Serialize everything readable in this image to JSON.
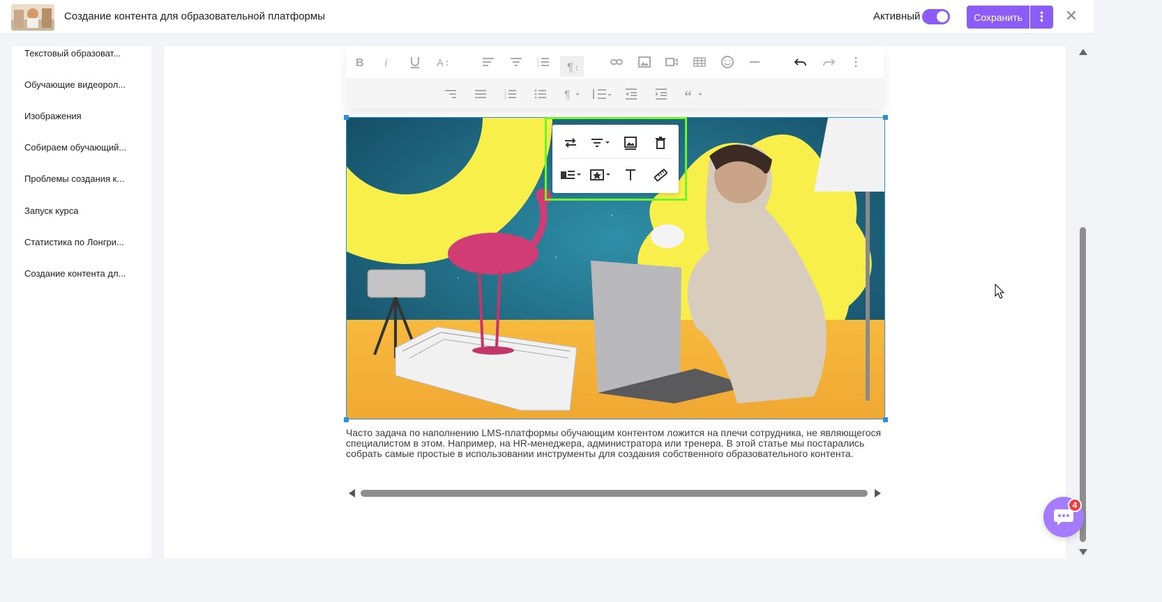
{
  "header": {
    "title": "Создание контента для образовательной платформы",
    "active_label": "Активный",
    "active_on": true,
    "save_label": "Сохранить",
    "more_icon": "vertical-dots-icon",
    "close_icon": "close-icon"
  },
  "sidebar": {
    "items": [
      {
        "label": "Текстовый образоват..."
      },
      {
        "label": "Обучающие видеорол..."
      },
      {
        "label": "Изображения"
      },
      {
        "label": "Собираем обучающий..."
      },
      {
        "label": "Проблемы создания к..."
      },
      {
        "label": "Запуск курса"
      },
      {
        "label": "Статистика по Лонгри..."
      },
      {
        "label": "Создание контента дл..."
      }
    ]
  },
  "toolbar": {
    "row1": [
      "bold-icon",
      "italic-icon",
      "underline-icon",
      "font-size-icon",
      "align-left-icon",
      "align-center-icon",
      "ordered-list-icon",
      "paragraph-format-icon",
      "link-icon",
      "image-icon",
      "video-icon",
      "table-icon",
      "emoji-icon",
      "horizontal-line-icon",
      "undo-icon",
      "redo-icon",
      "more-icon"
    ],
    "row2": [
      "align-right-icon",
      "align-justify-icon",
      "ordered-list-icon",
      "unordered-list-icon",
      "paragraph-style-icon",
      "line-height-icon",
      "outdent-icon",
      "indent-icon",
      "quote-icon"
    ]
  },
  "image_popup": {
    "icons": [
      "replace-image-icon",
      "align-image-icon",
      "insert-image-icon",
      "remove-image-icon",
      "display-icon",
      "style-icon",
      "alt-text-icon",
      "resize-ruler-icon"
    ]
  },
  "article": {
    "text": "Часто задача по наполнению LMS-платформы обучающим контентом ложится на плечи сотрудника, не являющегося специалистом в этом. Например, на HR-менеджера, администратора или тренера. В этой статье мы постарались собрать самые простые в использовании инструменты для создания собственного образовательного контента."
  },
  "chat": {
    "badge_count": "4"
  },
  "colors": {
    "accent": "#8b5cf6",
    "selection": "#2b8fe0",
    "highlight": "#6ef52a"
  }
}
